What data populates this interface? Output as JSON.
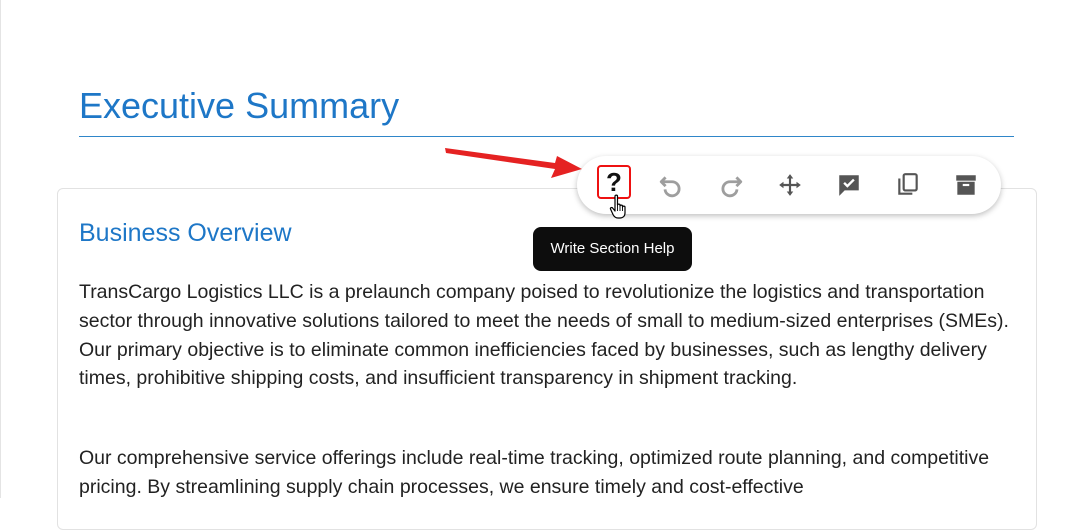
{
  "page": {
    "title": "Executive Summary"
  },
  "section": {
    "title": "Business Overview",
    "paragraphs": [
      "TransCargo Logistics LLC is a prelaunch company poised to revolutionize the logistics and transportation sector through innovative solutions tailored to meet the needs of small to medium-sized enterprises (SMEs). Our primary objective is to eliminate common inefficiencies faced by businesses, such as lengthy delivery times, prohibitive shipping costs, and insufficient transparency in shipment tracking.",
      "Our comprehensive service offerings include real-time tracking, optimized route planning, and competitive pricing. By streamlining supply chain processes, we ensure timely and cost-effective"
    ]
  },
  "toolbar": {
    "help_label": "?",
    "tooltip": "Write Section Help",
    "icons": [
      "help-icon",
      "undo-icon",
      "redo-icon",
      "move-icon",
      "approve-icon",
      "copy-icon",
      "archive-icon"
    ]
  },
  "colors": {
    "heading": "#1e77c7",
    "highlight": "#ee1111",
    "annotation_arrow": "#e52222"
  }
}
